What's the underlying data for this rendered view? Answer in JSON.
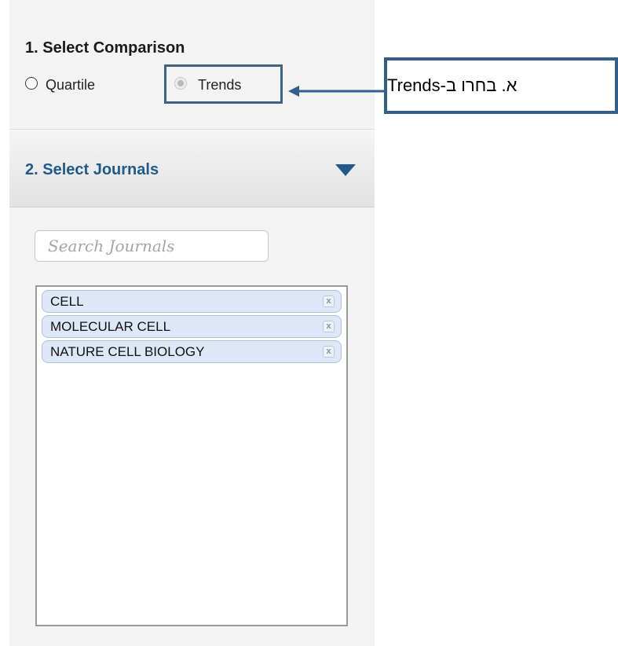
{
  "comparison": {
    "title": "1. Select Comparison",
    "options": [
      {
        "label": "Quartile",
        "selected": false
      },
      {
        "label": "Trends",
        "selected": true,
        "disabled": true
      }
    ]
  },
  "callout": {
    "text": "א.  בחרו ב-Trends"
  },
  "journals_section": {
    "title": "2. Select Journals",
    "toggle_icon": "triangle-down-icon"
  },
  "search": {
    "placeholder": "Search Journals",
    "value": ""
  },
  "journals": [
    {
      "name": "CELL",
      "remove_icon": "x"
    },
    {
      "name": "MOLECULAR CELL",
      "remove_icon": "x"
    },
    {
      "name": "NATURE CELL BIOLOGY",
      "remove_icon": "x"
    }
  ],
  "colors": {
    "accent": "#1f5a8a",
    "callout_border": "#2f5f8a",
    "chip_bg": "#dde7f7"
  }
}
